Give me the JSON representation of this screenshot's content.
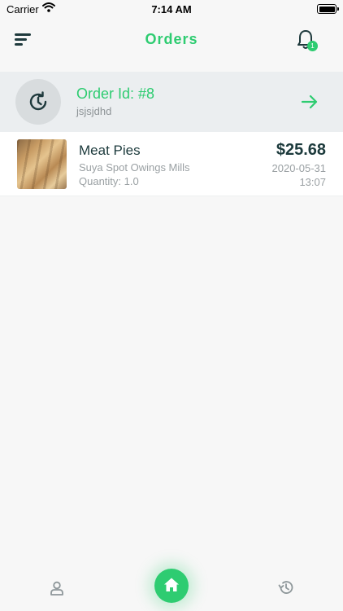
{
  "status_bar": {
    "carrier": "Carrier",
    "time": "7:14 AM"
  },
  "header": {
    "title": "Orders",
    "notification_count": "1"
  },
  "order": {
    "id_label": "Order Id: #8",
    "note": "jsjsjdhd"
  },
  "items": [
    {
      "name": "Meat Pies",
      "restaurant": "Suya Spot Owings Mills",
      "quantity": "Quantity: 1.0",
      "price": "$25.68",
      "date": "2020-05-31",
      "time": "13:07"
    }
  ],
  "colors": {
    "accent": "#2ecc71",
    "dark_text": "#1c3a3c",
    "muted_text": "#9aa0a3"
  },
  "icons": {
    "menu": "menu-lines-icon",
    "bell": "bell-icon",
    "order_status": "history-clock-icon",
    "arrow": "arrow-right-icon",
    "profile": "user-icon",
    "home": "home-icon",
    "history": "history-icon"
  }
}
